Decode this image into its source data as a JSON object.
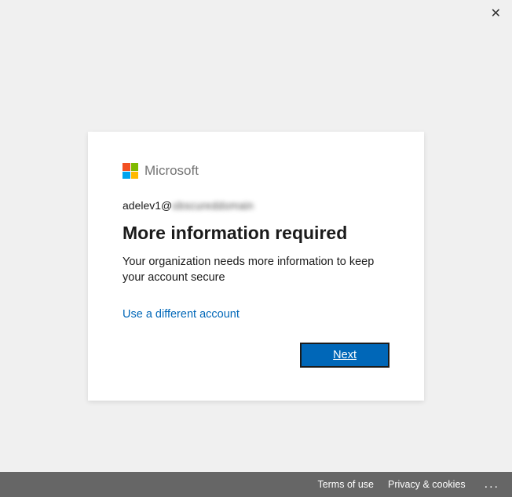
{
  "brand": {
    "name": "Microsoft"
  },
  "account": {
    "email_local": "adelev1@",
    "email_domain_obscured": "obscureddomain"
  },
  "dialog": {
    "title": "More information required",
    "description": "Your organization needs more information to keep your account secure",
    "alt_account_label": "Use a different account",
    "next_label": "Next"
  },
  "footer": {
    "terms_label": "Terms of use",
    "privacy_label": "Privacy & cookies",
    "more_label": "..."
  }
}
